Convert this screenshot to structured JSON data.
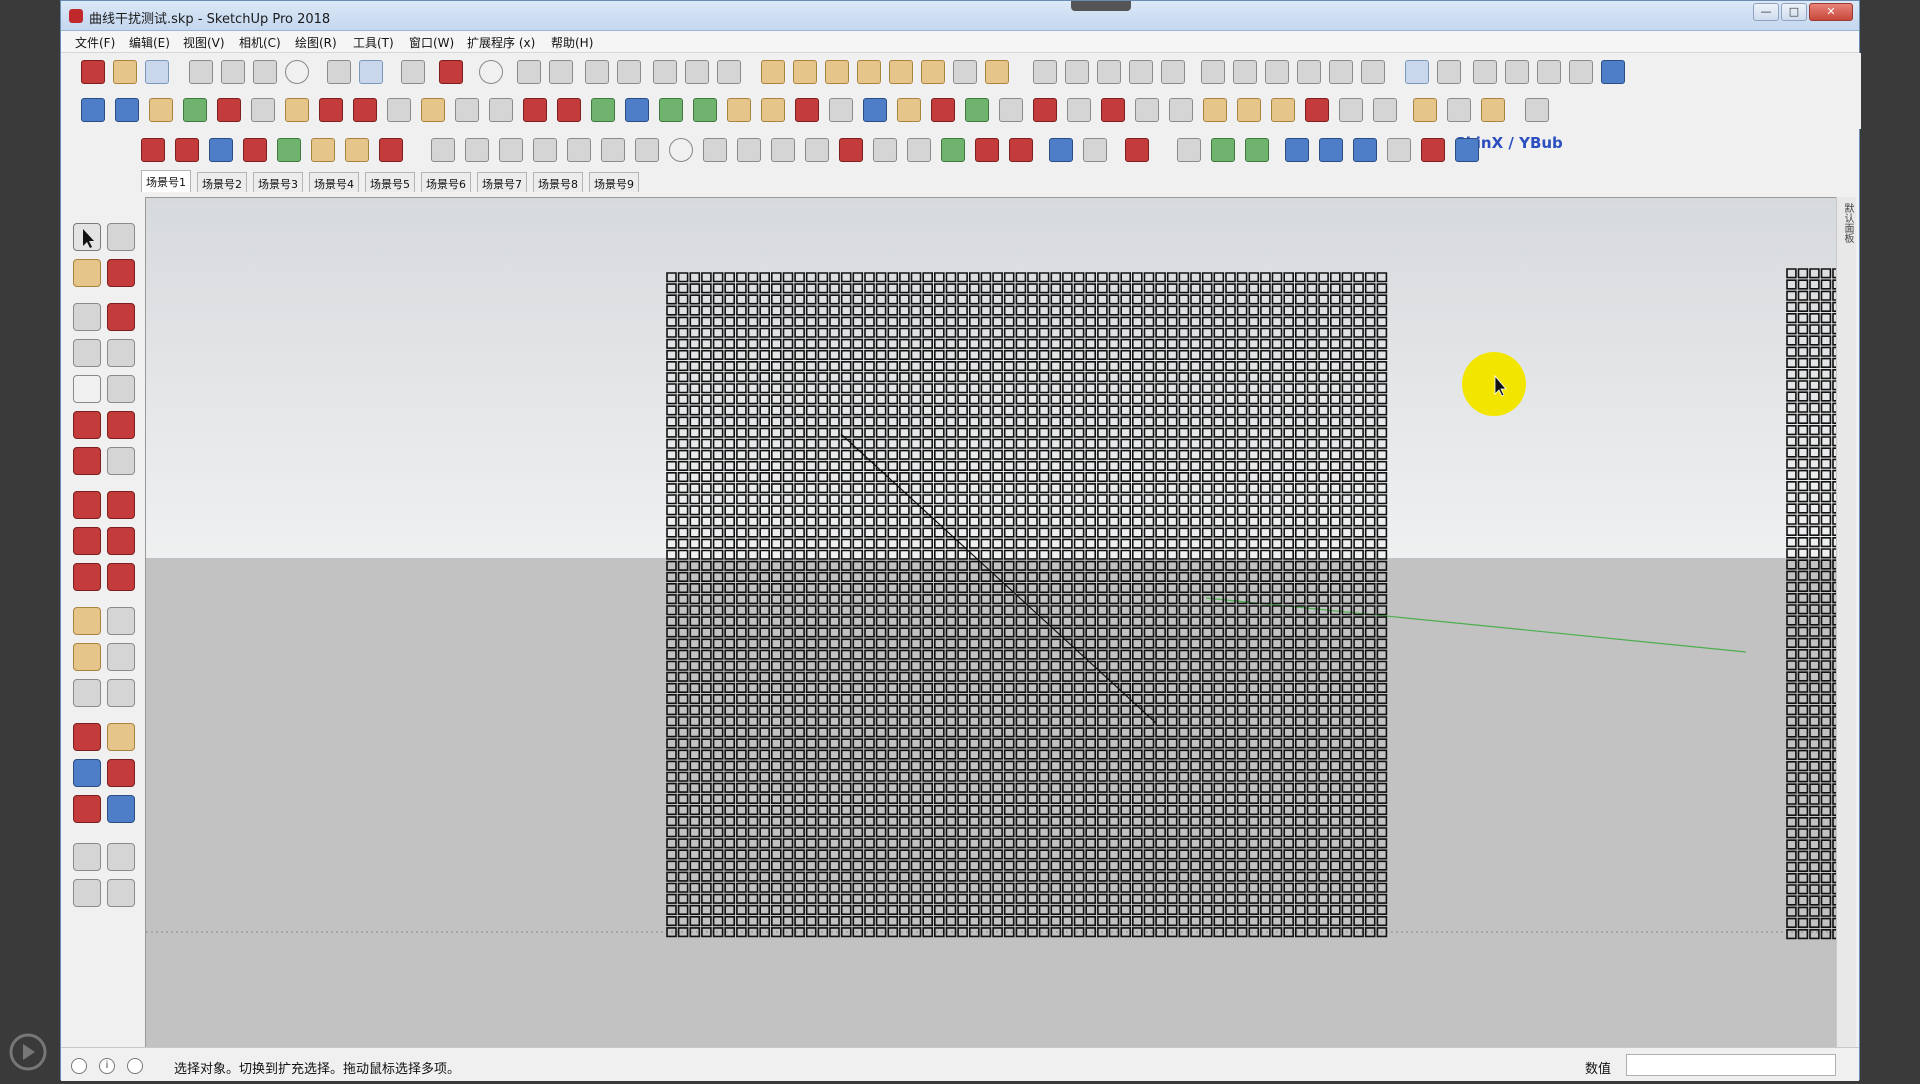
{
  "window": {
    "title": "曲线干扰测试.skp - SketchUp Pro 2018",
    "minimize_label": "—",
    "maximize_label": "□",
    "close_label": "✕"
  },
  "menu": [
    {
      "label": "文件(F)"
    },
    {
      "label": "编辑(E)"
    },
    {
      "label": "视图(V)"
    },
    {
      "label": "相机(C)"
    },
    {
      "label": "绘图(R)"
    },
    {
      "label": "工具(T)"
    },
    {
      "label": "窗口(W)"
    },
    {
      "label": "扩展程序 (x)"
    },
    {
      "label": "帮助(H)"
    }
  ],
  "toolbar": {
    "skinx_label": "SkinX / YBub"
  },
  "scenes": [
    {
      "label": "场景号1",
      "active": true
    },
    {
      "label": "场景号2"
    },
    {
      "label": "场景号3"
    },
    {
      "label": "场景号4"
    },
    {
      "label": "场景号5"
    },
    {
      "label": "场景号6"
    },
    {
      "label": "场景号7"
    },
    {
      "label": "场景号8"
    },
    {
      "label": "场景号9"
    }
  ],
  "side_panel": {
    "label": "默认面板"
  },
  "statusbar": {
    "message": "选择对象。切换到扩充选择。拖动鼠标选择多项。",
    "value_label": "数值",
    "value": ""
  },
  "colors": {
    "sky": "#e3e5e7",
    "ground": "#c2c2c2",
    "grid_line": "#111111",
    "cursor_highlight": "#f2e600",
    "axis_green": "#4caf50"
  },
  "icons": {
    "cursor": "cursor-arrow-icon",
    "highlight": "click-highlight-icon"
  }
}
